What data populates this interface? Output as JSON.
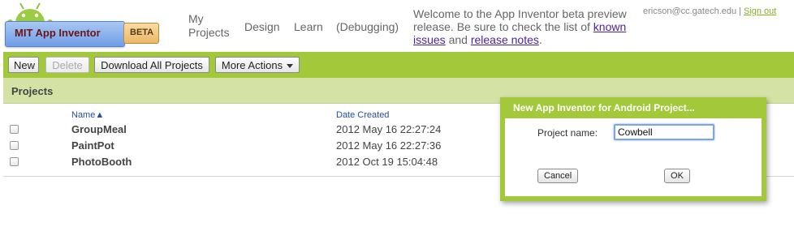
{
  "header": {
    "logo": {
      "title": "MIT App Inventor",
      "badge": "BETA",
      "icon": "android-robot-icon"
    },
    "nav": [
      {
        "label_line1": "My",
        "label_line2": "Projects"
      },
      {
        "label": "Design"
      },
      {
        "label": "Learn"
      },
      {
        "label": "(Debugging)"
      }
    ],
    "welcome": {
      "text_before": "Welcome to the App Inventor beta preview release. Be sure to check the list of ",
      "link_known_issues": "known issues",
      "text_middle": " and ",
      "link_release_notes": "release notes",
      "text_after": "."
    },
    "account": {
      "email": "ericson@cc.gatech.edu",
      "separator": "|",
      "sign_out": "Sign out"
    }
  },
  "toolbar": {
    "new_label": "New",
    "delete_label": "Delete",
    "download_all_label": "Download All Projects",
    "more_actions_label": "More Actions"
  },
  "projects": {
    "title": "Projects",
    "columns": {
      "name": "Name▲",
      "date_created": "Date Created"
    },
    "rows": [
      {
        "name": "GroupMeal",
        "date": "2012 May 16 22:27:24"
      },
      {
        "name": "PaintPot",
        "date": "2012 May 16 22:27:36"
      },
      {
        "name": "PhotoBooth",
        "date": "2012 Oct 19 15:04:48"
      }
    ]
  },
  "dialog": {
    "title": "New App Inventor for Android Project...",
    "label": "Project name:",
    "input_value": "Cowbell",
    "cancel_label": "Cancel",
    "ok_label": "OK"
  },
  "colors": {
    "accent_green": "#a3c93a",
    "panel_green": "#d4e2a6",
    "link_purple": "#4a1fa0",
    "signout_green": "#7fb320"
  }
}
